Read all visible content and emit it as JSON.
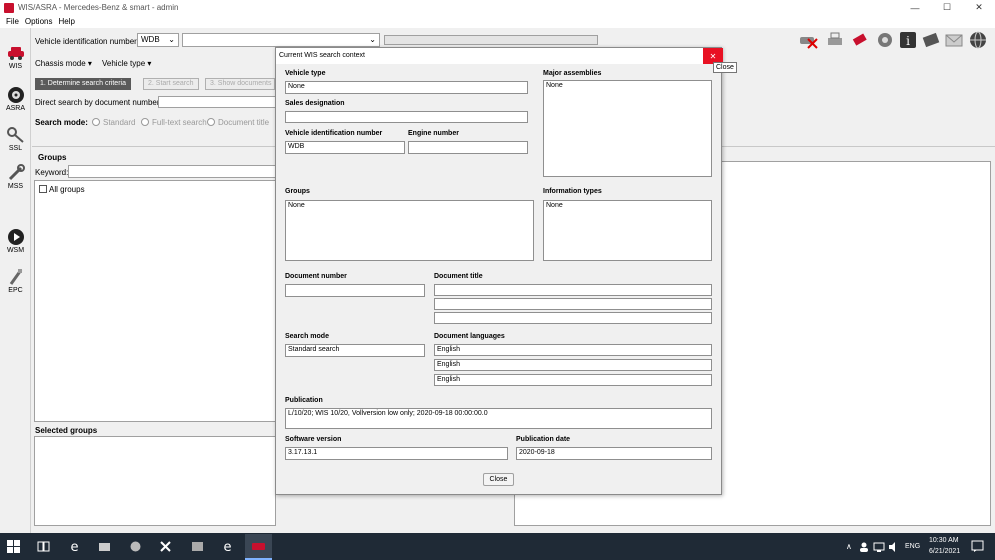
{
  "window": {
    "title": "WIS/ASRA - Mercedes-Benz & smart - admin",
    "minimize": "—",
    "maximize": "☐",
    "close": "✕"
  },
  "menu": [
    "File",
    "Options",
    "Help"
  ],
  "sidebar": [
    {
      "label": "WIS",
      "icon": "car-icon"
    },
    {
      "label": "ASRA",
      "icon": "wheel-icon"
    },
    {
      "label": "SSL",
      "icon": "key-icon"
    },
    {
      "label": "MSS",
      "icon": "wrench-icon"
    },
    {
      "label": "WSM",
      "icon": "play-icon"
    },
    {
      "label": "EPC",
      "icon": "spark-plug-icon"
    }
  ],
  "toolbar": {
    "vin_label": "Vehicle identification number",
    "vin_prefix": "WDB",
    "vin_value": "",
    "chassis_mode": "Chassis mode",
    "vehicle_type": "Vehicle type",
    "icons": [
      "clear-vehicle-icon",
      "print-icon",
      "eraser-icon",
      "settings-icon",
      "info-icon",
      "book-icon",
      "mail-icon",
      "globe-icon"
    ]
  },
  "steps": {
    "step1": "1. Determine search criteria",
    "step2": "2. Start search",
    "step3": "3. Show documents"
  },
  "search": {
    "direct_label": "Direct search by document number:",
    "mode_label": "Search mode:",
    "modes": [
      "Standard",
      "Full-text search",
      "Document title"
    ]
  },
  "groups": {
    "header": "Groups",
    "keyword_label": "Keyword:",
    "tree_root": "All groups",
    "selected_header": "Selected groups"
  },
  "dialog": {
    "title": "Current WIS search context",
    "close_tooltip": "Close",
    "vehicle_type_label": "Vehicle type",
    "vehicle_type_value": "None",
    "sales_designation_label": "Sales designation",
    "sales_designation_value": "",
    "vin_label": "Vehicle identification number",
    "vin_value": "WDB",
    "engine_number_label": "Engine number",
    "engine_number_value": "",
    "major_assemblies_label": "Major assemblies",
    "major_assemblies_value": "None",
    "groups_label": "Groups",
    "groups_value": "None",
    "info_types_label": "Information types",
    "info_types_value": "None",
    "doc_number_label": "Document number",
    "doc_number_value": "",
    "doc_title_label": "Document title",
    "doc_title_values": [
      "",
      "",
      ""
    ],
    "search_mode_label": "Search mode",
    "search_mode_value": "Standard search",
    "doc_languages_label": "Document languages",
    "doc_languages_values": [
      "English",
      "English",
      "English"
    ],
    "publication_label": "Publication",
    "publication_value": "L/10/20; WIS 10/20, Vollversion low only; 2020-09-18 00:00:00.0",
    "software_version_label": "Software version",
    "software_version_value": "3.17.13.1",
    "publication_date_label": "Publication date",
    "publication_date_value": "2020-09-18",
    "close_button": "Close"
  },
  "taskbar": {
    "time": "10:30 AM",
    "date": "6/21/2021",
    "language": "ENG",
    "tray_chevron": "∧"
  }
}
